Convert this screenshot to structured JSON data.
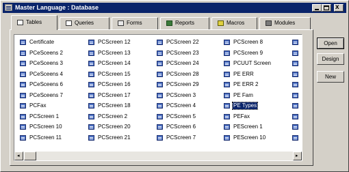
{
  "window": {
    "title": "Master Language : Database"
  },
  "title_buttons": {
    "minimize": "_",
    "maximize": "",
    "close": "x"
  },
  "tabs": [
    {
      "label": "Tables",
      "icon": "table-icon",
      "active": true
    },
    {
      "label": "Queries",
      "icon": "query-icon"
    },
    {
      "label": "Forms",
      "icon": "form-icon"
    },
    {
      "label": "Reports",
      "icon": "report-icon"
    },
    {
      "label": "Macros",
      "icon": "macro-icon"
    },
    {
      "label": "Modules",
      "icon": "module-icon"
    }
  ],
  "tables": {
    "columns": [
      [
        "Certificate",
        "PCeSceens 2",
        "PCeSceens 3",
        "PCeSceens 4",
        "PCeSceens 6",
        "PCeSceens 7",
        "PCFax",
        "PCScreen 1",
        "PCScreen 10",
        "PCScreen 11"
      ],
      [
        "PCScreen 12",
        "PCScreen 13",
        "PCScreen 14",
        "PCScreen 15",
        "PCScreen 16",
        "PCScreen 17",
        "PCScreen 18",
        "PCScreen 2",
        "PCScreen 20",
        "PCScreen 21"
      ],
      [
        "PCScreen 22",
        "PCScreen 23",
        "PCScreen 24",
        "PCScreen 28",
        "PCScreen 29",
        "PCScreen 3",
        "PCScreen 4",
        "PCScreen 5",
        "PCScreen 6",
        "PCScreen 7"
      ],
      [
        "PCScreen 8",
        "PCScreen 9",
        "PCUUT Screen",
        "PE ERR",
        "PE ERR 2",
        "PE Fam",
        "PE Types",
        "PEFax",
        "PEScreen 1",
        "PEScreen 10"
      ]
    ],
    "selected": "PE Types"
  },
  "scrollbar": {
    "left_arrow": "◂",
    "right_arrow": "▸"
  },
  "buttons": {
    "open": "Open",
    "design": "Design",
    "new": "New"
  },
  "colors": {
    "titlebar": "#0a246a",
    "face": "#d4d0c8",
    "selection": "#0a246a"
  }
}
